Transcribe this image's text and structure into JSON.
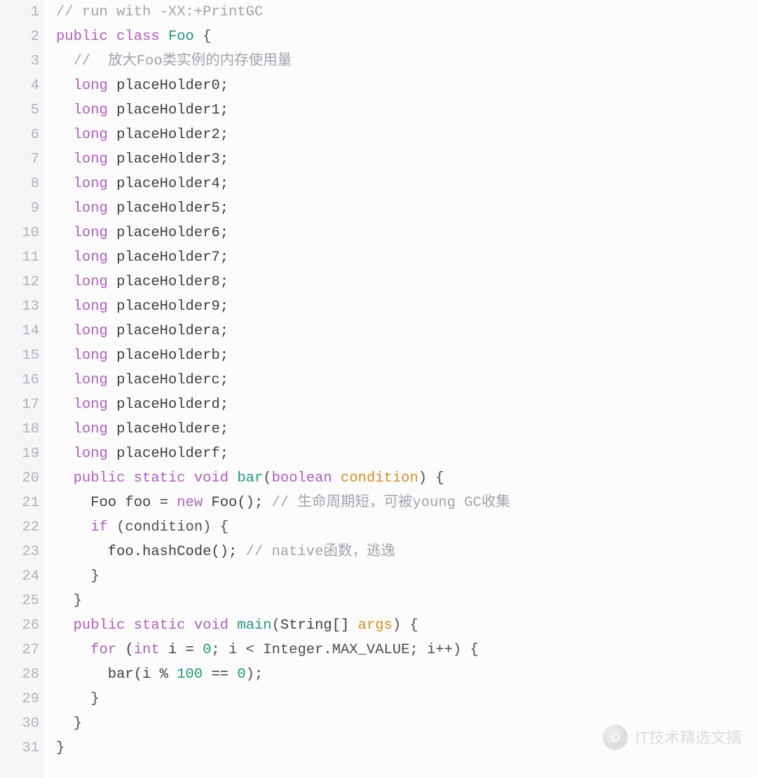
{
  "watermark": {
    "text": "IT技术精选文摘",
    "glyph": "✿"
  },
  "lines": [
    {
      "n": "1",
      "tokens": [
        {
          "t": "// run with -XX:+PrintGC",
          "c": "tok-comment"
        }
      ]
    },
    {
      "n": "2",
      "tokens": [
        {
          "t": "public",
          "c": "tok-keyword"
        },
        {
          "t": " "
        },
        {
          "t": "class",
          "c": "tok-keyword"
        },
        {
          "t": " "
        },
        {
          "t": "Foo",
          "c": "tok-class"
        },
        {
          "t": " {",
          "c": "tok-punct"
        }
      ]
    },
    {
      "n": "3",
      "tokens": [
        {
          "t": "  "
        },
        {
          "t": "//  放大Foo类实例的内存使用量",
          "c": "tok-comment"
        }
      ]
    },
    {
      "n": "4",
      "tokens": [
        {
          "t": "  "
        },
        {
          "t": "long",
          "c": "tok-keyword"
        },
        {
          "t": " placeHolder0;"
        }
      ]
    },
    {
      "n": "5",
      "tokens": [
        {
          "t": "  "
        },
        {
          "t": "long",
          "c": "tok-keyword"
        },
        {
          "t": " placeHolder1;"
        }
      ]
    },
    {
      "n": "6",
      "tokens": [
        {
          "t": "  "
        },
        {
          "t": "long",
          "c": "tok-keyword"
        },
        {
          "t": " placeHolder2;"
        }
      ]
    },
    {
      "n": "7",
      "tokens": [
        {
          "t": "  "
        },
        {
          "t": "long",
          "c": "tok-keyword"
        },
        {
          "t": " placeHolder3;"
        }
      ]
    },
    {
      "n": "8",
      "tokens": [
        {
          "t": "  "
        },
        {
          "t": "long",
          "c": "tok-keyword"
        },
        {
          "t": " placeHolder4;"
        }
      ]
    },
    {
      "n": "9",
      "tokens": [
        {
          "t": "  "
        },
        {
          "t": "long",
          "c": "tok-keyword"
        },
        {
          "t": " placeHolder5;"
        }
      ]
    },
    {
      "n": "10",
      "tokens": [
        {
          "t": "  "
        },
        {
          "t": "long",
          "c": "tok-keyword"
        },
        {
          "t": " placeHolder6;"
        }
      ]
    },
    {
      "n": "11",
      "tokens": [
        {
          "t": "  "
        },
        {
          "t": "long",
          "c": "tok-keyword"
        },
        {
          "t": " placeHolder7;"
        }
      ]
    },
    {
      "n": "12",
      "tokens": [
        {
          "t": "  "
        },
        {
          "t": "long",
          "c": "tok-keyword"
        },
        {
          "t": " placeHolder8;"
        }
      ]
    },
    {
      "n": "13",
      "tokens": [
        {
          "t": "  "
        },
        {
          "t": "long",
          "c": "tok-keyword"
        },
        {
          "t": " placeHolder9;"
        }
      ]
    },
    {
      "n": "14",
      "tokens": [
        {
          "t": "  "
        },
        {
          "t": "long",
          "c": "tok-keyword"
        },
        {
          "t": " placeHoldera;"
        }
      ]
    },
    {
      "n": "15",
      "tokens": [
        {
          "t": "  "
        },
        {
          "t": "long",
          "c": "tok-keyword"
        },
        {
          "t": " placeHolderb;"
        }
      ]
    },
    {
      "n": "16",
      "tokens": [
        {
          "t": "  "
        },
        {
          "t": "long",
          "c": "tok-keyword"
        },
        {
          "t": " placeHolderc;"
        }
      ]
    },
    {
      "n": "17",
      "tokens": [
        {
          "t": "  "
        },
        {
          "t": "long",
          "c": "tok-keyword"
        },
        {
          "t": " placeHolderd;"
        }
      ]
    },
    {
      "n": "18",
      "tokens": [
        {
          "t": "  "
        },
        {
          "t": "long",
          "c": "tok-keyword"
        },
        {
          "t": " placeHoldere;"
        }
      ]
    },
    {
      "n": "19",
      "tokens": [
        {
          "t": "  "
        },
        {
          "t": "long",
          "c": "tok-keyword"
        },
        {
          "t": " placeHolderf;"
        }
      ]
    },
    {
      "n": "20",
      "tokens": [
        {
          "t": "  "
        },
        {
          "t": "public",
          "c": "tok-keyword"
        },
        {
          "t": " "
        },
        {
          "t": "static",
          "c": "tok-keyword"
        },
        {
          "t": " "
        },
        {
          "t": "void",
          "c": "tok-keyword"
        },
        {
          "t": " "
        },
        {
          "t": "bar",
          "c": "tok-method"
        },
        {
          "t": "(",
          "c": "tok-punct"
        },
        {
          "t": "boolean",
          "c": "tok-keyword"
        },
        {
          "t": " "
        },
        {
          "t": "condition",
          "c": "tok-param"
        },
        {
          "t": ")",
          "c": "tok-punct"
        },
        {
          "t": " {",
          "c": "tok-punct"
        }
      ]
    },
    {
      "n": "21",
      "tokens": [
        {
          "t": "    Foo foo = "
        },
        {
          "t": "new",
          "c": "tok-keyword"
        },
        {
          "t": " Foo(); "
        },
        {
          "t": "// 生命周期短，可被young GC收集",
          "c": "tok-comment"
        }
      ]
    },
    {
      "n": "22",
      "tokens": [
        {
          "t": "    "
        },
        {
          "t": "if",
          "c": "tok-keyword"
        },
        {
          "t": " (condition) {",
          "c": "tok-punct"
        }
      ]
    },
    {
      "n": "23",
      "tokens": [
        {
          "t": "      foo.hashCode(); "
        },
        {
          "t": "// native函数，逃逸",
          "c": "tok-comment"
        }
      ]
    },
    {
      "n": "24",
      "tokens": [
        {
          "t": "    }",
          "c": "tok-punct"
        }
      ]
    },
    {
      "n": "25",
      "tokens": [
        {
          "t": "  }",
          "c": "tok-punct"
        }
      ]
    },
    {
      "n": "26",
      "tokens": [
        {
          "t": "  "
        },
        {
          "t": "public",
          "c": "tok-keyword"
        },
        {
          "t": " "
        },
        {
          "t": "static",
          "c": "tok-keyword"
        },
        {
          "t": " "
        },
        {
          "t": "void",
          "c": "tok-keyword"
        },
        {
          "t": " "
        },
        {
          "t": "main",
          "c": "tok-method"
        },
        {
          "t": "(",
          "c": "tok-punct"
        },
        {
          "t": "String[] "
        },
        {
          "t": "args",
          "c": "tok-param"
        },
        {
          "t": ")",
          "c": "tok-punct"
        },
        {
          "t": " {",
          "c": "tok-punct"
        }
      ]
    },
    {
      "n": "27",
      "tokens": [
        {
          "t": "    "
        },
        {
          "t": "for",
          "c": "tok-keyword"
        },
        {
          "t": " ("
        },
        {
          "t": "int",
          "c": "tok-keyword"
        },
        {
          "t": " i = "
        },
        {
          "t": "0",
          "c": "tok-number"
        },
        {
          "t": "; i < Integer.MAX_VALUE; i++) {",
          "c": "tok-punct"
        }
      ]
    },
    {
      "n": "28",
      "tokens": [
        {
          "t": "      bar(i % "
        },
        {
          "t": "100",
          "c": "tok-number"
        },
        {
          "t": " == "
        },
        {
          "t": "0",
          "c": "tok-number"
        },
        {
          "t": ");",
          "c": "tok-punct"
        }
      ]
    },
    {
      "n": "29",
      "tokens": [
        {
          "t": "    }",
          "c": "tok-punct"
        }
      ]
    },
    {
      "n": "30",
      "tokens": [
        {
          "t": "  }",
          "c": "tok-punct"
        }
      ]
    },
    {
      "n": "31",
      "tokens": [
        {
          "t": "}",
          "c": "tok-punct"
        }
      ]
    }
  ]
}
